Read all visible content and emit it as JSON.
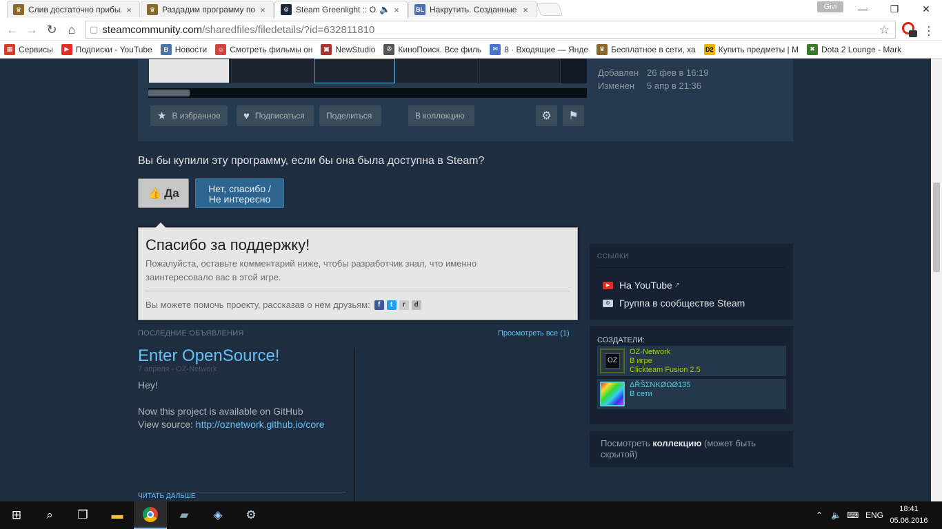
{
  "browser": {
    "tabs": [
      {
        "title": "Слив достаточно прибыл",
        "favicon": "fan-icon",
        "color": "#8a6a2a"
      },
      {
        "title": "Раздадим программу по",
        "favicon": "fan-icon",
        "color": "#8a6a2a"
      },
      {
        "title": "Steam Greenlight :: OZ",
        "favicon": "steam-icon",
        "color": "#1b2838"
      },
      {
        "title": "Накрутить. Созданные за",
        "favicon": "bl-icon",
        "color": "#4a6fb5"
      }
    ],
    "user_badge": "Givi",
    "address": {
      "host": "steamcommunity.com",
      "path": "/sharedfiles/filedetails/?id=632811810"
    },
    "bookmarks": [
      {
        "label": "Сервисы",
        "color": "#d93a2b"
      },
      {
        "label": "Подписки - YouTube",
        "color": "#e52d27"
      },
      {
        "label": "Новости",
        "color": "#4c75a3"
      },
      {
        "label": "Смотреть фильмы он",
        "color": "#c44"
      },
      {
        "label": "NewStudio",
        "color": "#a33"
      },
      {
        "label": "КиноПоиск. Все филь",
        "color": "#555"
      },
      {
        "label": "8 · Входящие — Янде",
        "color": "#4a74c9"
      },
      {
        "label": "Бесплатное в сети, ха",
        "color": "#8a6a2a"
      },
      {
        "label": "Купить предметы | M",
        "color": "#e8b400"
      },
      {
        "label": "Dota 2 Lounge - Mark",
        "color": "#3a7a2a"
      }
    ]
  },
  "item": {
    "added_label": "Добавлен",
    "added_value": "26 фев в 16:19",
    "updated_label": "Изменен",
    "updated_value": "5 апр в 21:36",
    "actions": {
      "favorite": "В избранное",
      "subscribe": "Подписаться",
      "share": "Поделиться",
      "collection": "В коллекцию"
    }
  },
  "vote": {
    "question": "Вы бы купили эту программу, если бы она была доступна в Steam?",
    "yes": "Да",
    "no_line1": "Нет, спасибо /",
    "no_line2": "Не интересно"
  },
  "thanks": {
    "title": "Спасибо за поддержку!",
    "desc_line1": "Пожалуйста, оставьте комментарий ниже, чтобы разработчик знал, что именно",
    "desc_line2": "заинтересовало вас в этой игре.",
    "share_text": "Вы можете помочь проекту, рассказав о нём друзьям:"
  },
  "announcements": {
    "header": "ПОСЛЕДНИЕ ОБЪЯВЛЕНИЯ",
    "view_all": "Просмотреть все (1)",
    "title": "Enter OpenSource!",
    "date": "7 апреля - OZ-Network",
    "line1": "Hey!",
    "line2": "Now this project is available on GitHub",
    "line3_prefix": "View source: ",
    "link": "http://oznetwork.github.io/core",
    "read_more": "ЧИТАТЬ ДАЛЬШЕ"
  },
  "sidebar": {
    "links_header": "ССЫЛКИ",
    "youtube": "На YouTube",
    "group": "Группа в сообществе Steam",
    "creators_header": "СОЗДАТЕЛИ:",
    "creators": [
      {
        "name": "OZ-Network",
        "status": "В игре",
        "game": "Clickteam Fusion 2.5",
        "status_color": "#a3cf06"
      },
      {
        "name": "ΔŘŠΣNKØΩØ135",
        "status": "В сети",
        "game": "",
        "status_color": "#57cbde"
      }
    ],
    "collection_prefix": "Посмотреть ",
    "collection_bold": "коллекцию",
    "collection_suffix": " (может быть скрытой)"
  },
  "taskbar": {
    "lang": "ENG",
    "time": "18:41",
    "date": "05.06.2016"
  }
}
